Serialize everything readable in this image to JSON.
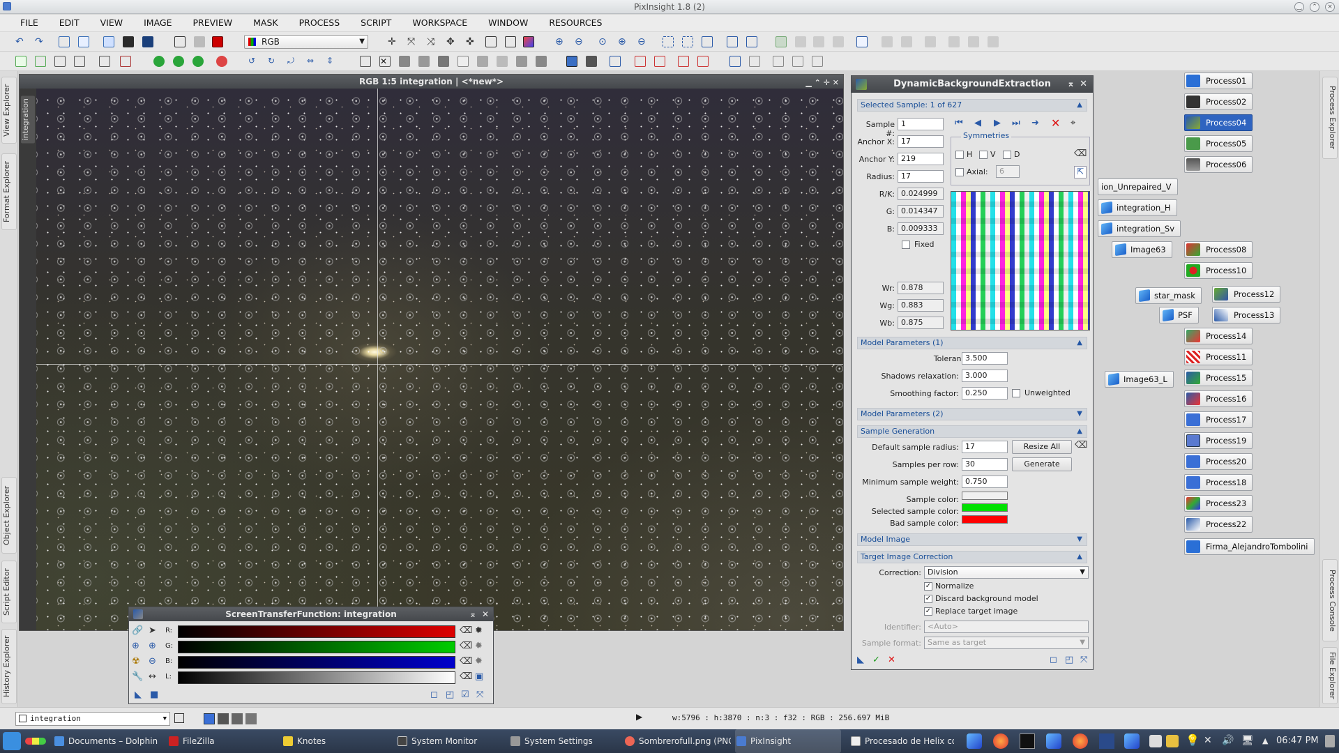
{
  "window": {
    "title": "PixInsight 1.8 (2)"
  },
  "menu": [
    "FILE",
    "EDIT",
    "VIEW",
    "IMAGE",
    "PREVIEW",
    "MASK",
    "PROCESS",
    "SCRIPT",
    "WORKSPACE",
    "WINDOW",
    "RESOURCES"
  ],
  "toolbar": {
    "color_space": "RGB"
  },
  "left_dock": {
    "tabs": [
      "View Explorer",
      "Format Explorer",
      "Object Explorer",
      "Script Editor",
      "History Explorer"
    ]
  },
  "right_dock": {
    "tabs": [
      "Process Explorer",
      "Process Console",
      "File Explorer"
    ]
  },
  "image_window": {
    "title": "RGB 1:5 integration | <*new*>",
    "side_tab": "integration"
  },
  "dbe": {
    "title": "DynamicBackgroundExtraction",
    "selected_sample_header": "Selected Sample: 1 of 627",
    "sample_label": "Sample #:",
    "sample_value": "1",
    "anchor_x_label": "Anchor X:",
    "anchor_x_value": "17",
    "anchor_y_label": "Anchor Y:",
    "anchor_y_value": "219",
    "radius_label": "Radius:",
    "radius_value": "17",
    "rk_label": "R/K:",
    "rk_value": "0.024999",
    "g_label": "G:",
    "g_value": "0.014347",
    "b_label": "B:",
    "b_value": "0.009333",
    "fixed_label": "Fixed",
    "wr_label": "Wr:",
    "wr_value": "0.878",
    "wg_label": "Wg:",
    "wg_value": "0.883",
    "wb_label": "Wb:",
    "wb_value": "0.875",
    "symmetries_label": "Symmetries",
    "sym_h": "H",
    "sym_v": "V",
    "sym_d": "D",
    "axial_label": "Axial:",
    "axial_value": "6",
    "model_params_1": "Model Parameters (1)",
    "tolerance_label": "Tolerance:",
    "tolerance_value": "3.500",
    "shadows_label": "Shadows relaxation:",
    "shadows_value": "3.000",
    "smoothing_label": "Smoothing factor:",
    "smoothing_value": "0.250",
    "unweighted_label": "Unweighted",
    "model_params_2": "Model Parameters (2)",
    "sample_generation": "Sample Generation",
    "default_radius_label": "Default sample radius:",
    "default_radius_value": "17",
    "resize_all": "Resize All",
    "samples_row_label": "Samples per row:",
    "samples_row_value": "30",
    "generate": "Generate",
    "min_weight_label": "Minimum sample weight:",
    "min_weight_value": "0.750",
    "sample_color_label": "Sample color:",
    "selected_color_label": "Selected sample color:",
    "bad_color_label": "Bad sample color:",
    "model_image": "Model Image",
    "target_correction": "Target Image Correction",
    "correction_label": "Correction:",
    "correction_value": "Division",
    "normalize_label": "Normalize",
    "discard_label": "Discard background model",
    "replace_label": "Replace target image",
    "identifier_label": "Identifier:",
    "identifier_placeholder": "<Auto>",
    "sample_format_label": "Sample format:",
    "sample_format_value": "Same as target"
  },
  "colors": {
    "sample": "#f0f0f0",
    "selected_sample": "#00e000",
    "bad_sample": "#ff0000",
    "accent": "#2f64c0"
  },
  "stf": {
    "title": "ScreenTransferFunction: integration",
    "r": "R:",
    "g": "G:",
    "b": "B:",
    "l": "L:"
  },
  "process_icons": [
    "Process01",
    "Process02",
    "Process04",
    "Process05",
    "Process06",
    "Process08",
    "Process10",
    "Process12",
    "Process13",
    "Process14",
    "Process11",
    "Process15",
    "Process16",
    "Process17",
    "Process19",
    "Process20",
    "Process18",
    "Process23",
    "Process22",
    "Firma_AlejandroTombolini"
  ],
  "image_icons": [
    "ion_Unrepaired_V",
    "integration_H",
    "integration_Sv",
    "Image63",
    "star_mask",
    "PSF",
    "Image63_L"
  ],
  "statusbar": {
    "view": "integration",
    "info": "w:5796 : h:3870 : n:3 : f32 : RGB : 256.697 MiB"
  },
  "taskbar": {
    "items": [
      "Documents – Dolphin",
      "FileZilla",
      "Knotes",
      "System Monitor",
      "System Settings",
      "Sombrerofull.png (PNG",
      "PixInsight",
      "Procesado de Helix co"
    ],
    "clock": "06:47 PM"
  }
}
